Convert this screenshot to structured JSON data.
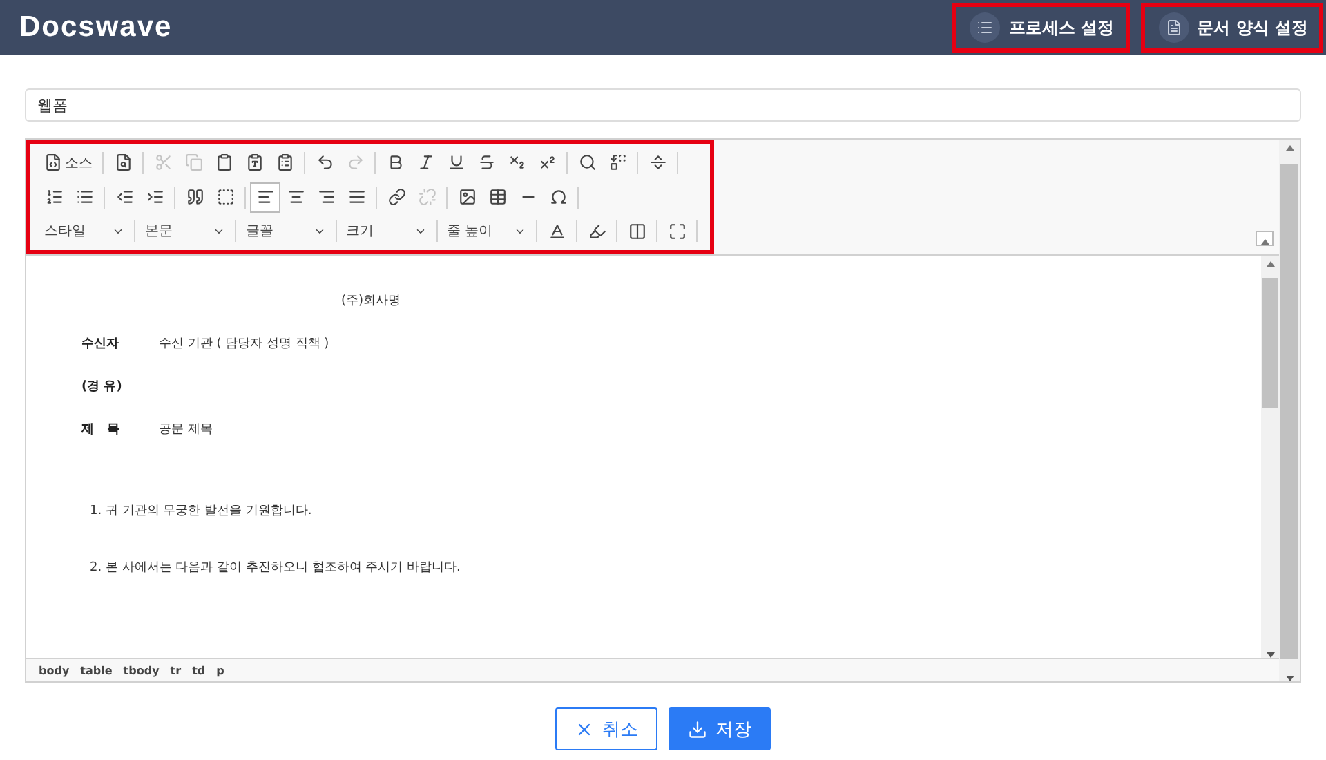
{
  "header": {
    "logo": "Docswave",
    "buttons": [
      {
        "label": "프로세스 설정",
        "kind": "process",
        "highlighted": true
      },
      {
        "label": "문서 양식 설정",
        "kind": "form",
        "highlighted": true
      }
    ]
  },
  "title_field": {
    "value": "웹폼"
  },
  "toolbar": {
    "highlighted": true,
    "rows": [
      [
        [
          {
            "kind": "source",
            "label": "소스",
            "disabled": false
          }
        ],
        [
          {
            "kind": "preview",
            "disabled": false
          }
        ],
        [
          {
            "kind": "cut",
            "disabled": true
          },
          {
            "kind": "copy",
            "disabled": true
          },
          {
            "kind": "paste",
            "disabled": false
          },
          {
            "kind": "paste-text",
            "disabled": false
          },
          {
            "kind": "paste-word",
            "disabled": false
          }
        ],
        [
          {
            "kind": "undo",
            "disabled": false
          },
          {
            "kind": "redo",
            "disabled": true
          }
        ],
        [
          {
            "kind": "bold",
            "disabled": false
          },
          {
            "kind": "italic",
            "disabled": false
          },
          {
            "kind": "underline",
            "disabled": false
          },
          {
            "kind": "strike",
            "disabled": false
          },
          {
            "kind": "sub",
            "disabled": false
          },
          {
            "kind": "sup",
            "disabled": false
          }
        ],
        [
          {
            "kind": "find",
            "disabled": false
          },
          {
            "kind": "replace",
            "disabled": false
          }
        ],
        [
          {
            "kind": "pagebreak",
            "disabled": false
          }
        ]
      ],
      [
        [
          {
            "kind": "ol",
            "disabled": false
          },
          {
            "kind": "ul",
            "disabled": false
          }
        ],
        [
          {
            "kind": "outdent",
            "disabled": false
          },
          {
            "kind": "indent",
            "disabled": false
          }
        ],
        [
          {
            "kind": "quote",
            "disabled": false
          },
          {
            "kind": "div",
            "disabled": false
          }
        ],
        [
          {
            "kind": "left",
            "disabled": false,
            "selected": true
          },
          {
            "kind": "center",
            "disabled": false,
            "selected": false
          },
          {
            "kind": "right",
            "disabled": false,
            "selected": false
          },
          {
            "kind": "justify",
            "disabled": false,
            "selected": false
          }
        ],
        [
          {
            "kind": "link",
            "disabled": false
          },
          {
            "kind": "unlink",
            "disabled": true
          }
        ],
        [
          {
            "kind": "image",
            "disabled": false
          },
          {
            "kind": "table",
            "disabled": false
          },
          {
            "kind": "hr",
            "disabled": false
          },
          {
            "kind": "omega",
            "disabled": false
          }
        ]
      ]
    ],
    "dropdowns": [
      {
        "label": "스타일"
      },
      {
        "label": "본문"
      },
      {
        "label": "글꼴"
      },
      {
        "label": "크기"
      },
      {
        "label": "줄 높이"
      }
    ],
    "extra": [
      {
        "kind": "textcolor"
      },
      {
        "kind": "bgcolor"
      },
      {
        "kind": "blocks"
      },
      {
        "kind": "maximize"
      }
    ]
  },
  "document": {
    "company": "(주)회사명",
    "fields": [
      {
        "label": "수신자",
        "value": "수신 기관 ( 담당자 성명 직책 )"
      },
      {
        "label": "(경 유)"
      },
      {
        "label": "제   목",
        "value": "공문 제목"
      }
    ],
    "paragraphs": [
      "1. 귀 기관의 무궁한 발전을 기원합니다.",
      "2. 본 사에서는 다음과 같이 추진하오니 협조하여 주시기 바랍니다."
    ]
  },
  "path": [
    "body",
    "table",
    "tbody",
    "tr",
    "td",
    "p"
  ],
  "actions": [
    {
      "label": "취소",
      "kind": "cancel"
    },
    {
      "label": "저장",
      "kind": "save"
    }
  ]
}
